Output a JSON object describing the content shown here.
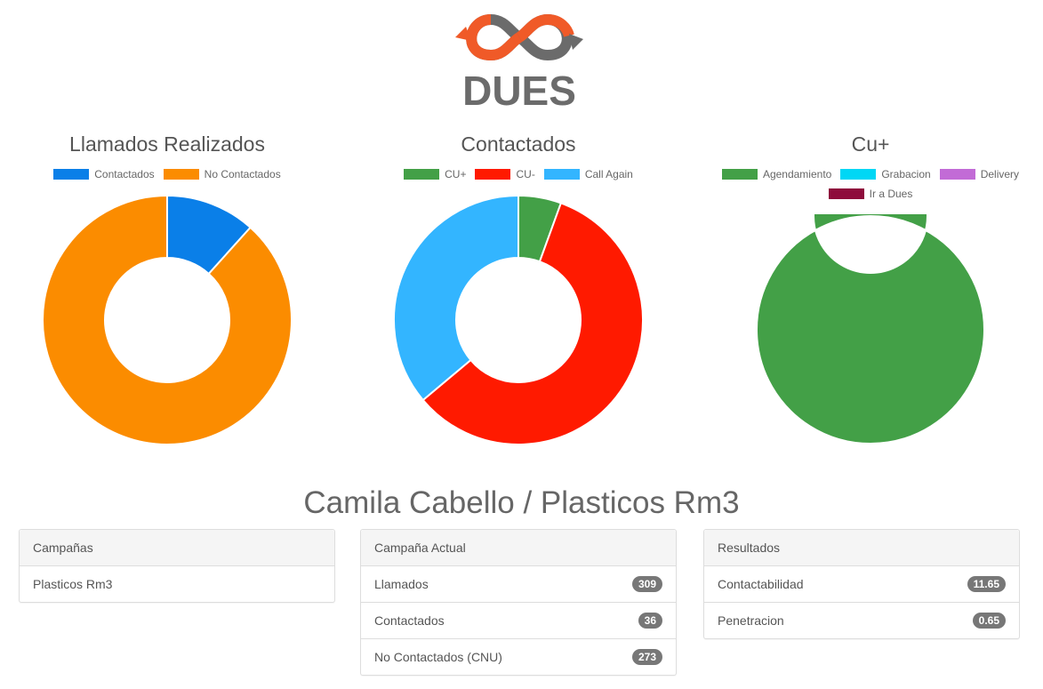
{
  "logo": {
    "text": "DUES"
  },
  "charts_text": {
    "c1_title": "Llamados Realizados",
    "c2_title": "Contactados",
    "c3_title": "Cu+"
  },
  "chart_data": [
    {
      "type": "pie",
      "title": "Llamados Realizados",
      "categories": [
        "Contactados",
        "No Contactados"
      ],
      "values": [
        36,
        273
      ],
      "colors": [
        "#0a7fe8",
        "#fb8c00"
      ],
      "legend": "top"
    },
    {
      "type": "pie",
      "title": "Contactados",
      "categories": [
        "CU+",
        "CU-",
        "Call Again"
      ],
      "values": [
        2,
        21,
        13
      ],
      "colors": [
        "#43a047",
        "#ff1a00",
        "#33b5ff"
      ],
      "legend": "top"
    },
    {
      "type": "pie",
      "title": "Cu+",
      "categories": [
        "Agendamiento",
        "Grabacion",
        "Delivery",
        "Ir a Dues"
      ],
      "values": [
        2,
        0,
        0,
        0
      ],
      "colors": [
        "#43a047",
        "#00d7f5",
        "#c26bd6",
        "#8e0c3c"
      ],
      "legend": "top"
    }
  ],
  "page_title": "Camila Cabello / Plasticos Rm3",
  "panels": {
    "campanas": {
      "heading": "Campañas",
      "items": [
        {
          "label": "Plasticos Rm3"
        }
      ]
    },
    "actual": {
      "heading": "Campaña Actual",
      "items": [
        {
          "label": "Llamados",
          "value": "309"
        },
        {
          "label": "Contactados",
          "value": "36"
        },
        {
          "label": "No Contactados (CNU)",
          "value": "273"
        }
      ]
    },
    "resultados": {
      "heading": "Resultados",
      "items": [
        {
          "label": "Contactabilidad",
          "value": "11.65"
        },
        {
          "label": "Penetracion",
          "value": "0.65"
        }
      ]
    }
  }
}
